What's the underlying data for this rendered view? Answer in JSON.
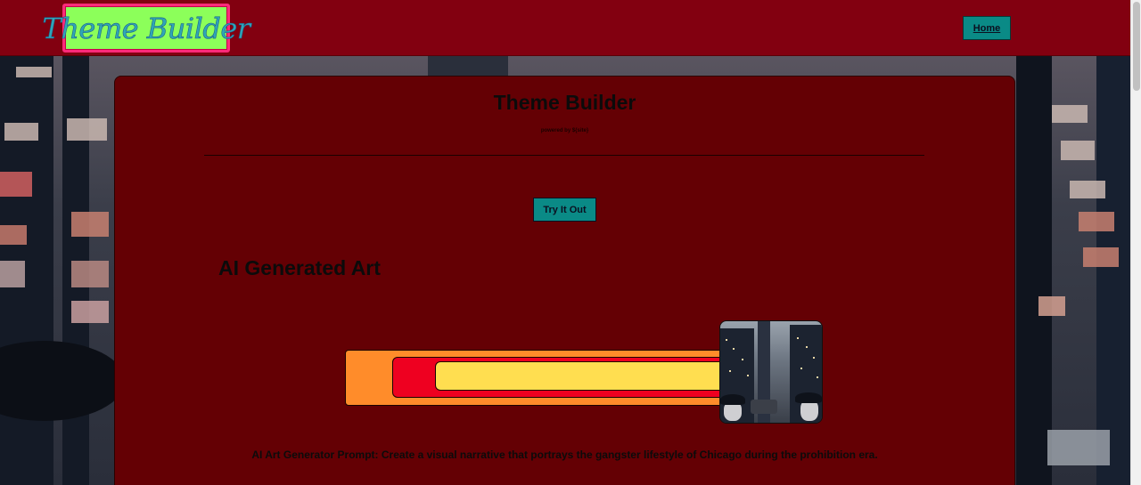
{
  "header": {
    "logo_text": "Theme Builder",
    "home_label": "Home"
  },
  "card": {
    "title": "Theme Builder",
    "subtitle": "powered by ${site}",
    "cta_label": "Try It Out",
    "section_heading": "AI Generated Art",
    "caption": "AI Art Generator Prompt: Create a visual narrative that portrays the gangster lifestyle of Chicago during the prohibition era."
  },
  "colors": {
    "topbar": "#820010",
    "card": "#640004",
    "button": "#0a8a86",
    "logo_bg": "#8cff5a",
    "logo_border": "#ff2a7a",
    "bar_orange": "#ff8c2a",
    "bar_red": "#ee0020",
    "bar_yellow": "#ffde50"
  }
}
